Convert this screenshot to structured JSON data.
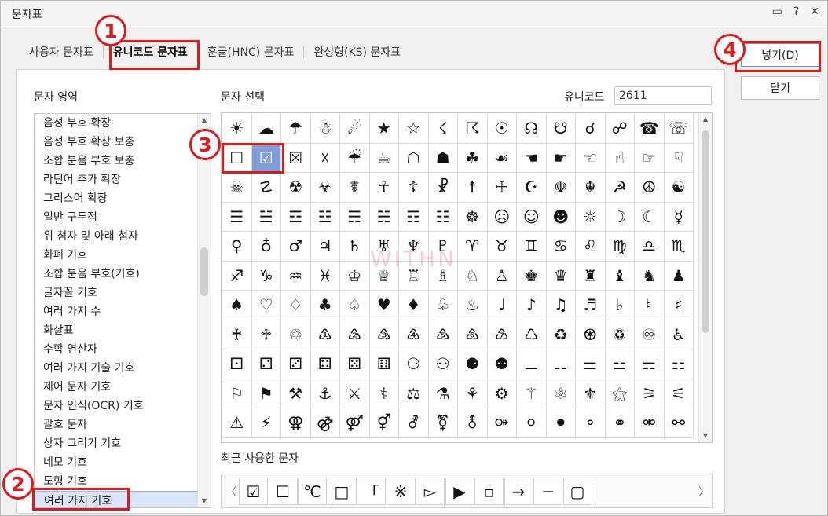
{
  "window": {
    "title": "문자표",
    "icons": [
      "comment-icon",
      "help-icon",
      "close-icon"
    ],
    "help_glyph": "?",
    "close_glyph": "✕",
    "comment_glyph": "▭"
  },
  "tabs": [
    {
      "label": "사용자 문자표",
      "active": false
    },
    {
      "label": "유니코드 문자표",
      "active": true
    },
    {
      "label": "훈글(HNC) 문자표",
      "active": false
    },
    {
      "label": "완성형(KS) 문자표",
      "active": false
    }
  ],
  "left": {
    "label": "문자 영역",
    "items": [
      "음성 부호 확장",
      "음성 부호 확장 보충",
      "조합 분음 부호 보충",
      "라틴어 추가 확장",
      "그리스어 확장",
      "일반 구두점",
      "위 첨자 및 아래 첨자",
      "화폐 기호",
      "조합 분음 부호(기호)",
      "글자꼴 기호",
      "여러 가지 수",
      "화살표",
      "수학 연산자",
      "여러 가지 기술 기호",
      "제어 문자 기호",
      "문자 인식(OCR) 기호",
      "괄호 문자",
      "상자 그리기 기호",
      "네모 기호",
      "도형 기호",
      "여러 가지 기호"
    ],
    "selected_index": 20
  },
  "center": {
    "label": "문자 선택",
    "unicode_label": "유니코드",
    "unicode_value": "2611",
    "selected_row": 1,
    "selected_col": 1,
    "rows": [
      [
        "☀",
        "☁",
        "☂",
        "☃",
        "☄",
        "★",
        "☆",
        "☇",
        "☈",
        "☉",
        "☊",
        "☋",
        "☌",
        "☍",
        "☎",
        "☏"
      ],
      [
        "☐",
        "☑",
        "☒",
        "☓",
        "☔",
        "☕",
        "☖",
        "☗",
        "☘",
        "☙",
        "☚",
        "☛",
        "☜",
        "☝",
        "☞",
        "☟"
      ],
      [
        "☠",
        "☡",
        "☢",
        "☣",
        "☤",
        "☥",
        "☦",
        "☧",
        "☨",
        "☩",
        "☪",
        "☫",
        "☬",
        "☭",
        "☮",
        "☯"
      ],
      [
        "☰",
        "☱",
        "☲",
        "☳",
        "☴",
        "☵",
        "☶",
        "☷",
        "☸",
        "☹",
        "☺",
        "☻",
        "☼",
        "☽",
        "☾",
        "☿"
      ],
      [
        "♀",
        "♁",
        "♂",
        "♃",
        "♄",
        "♅",
        "♆",
        "♇",
        "♈",
        "♉",
        "♊",
        "♋",
        "♌",
        "♍",
        "♎",
        "♏"
      ],
      [
        "♐",
        "♑",
        "♒",
        "♓",
        "♔",
        "♕",
        "♖",
        "♗",
        "♘",
        "♙",
        "♚",
        "♛",
        "♜",
        "♝",
        "♞",
        "♟"
      ],
      [
        "♠",
        "♡",
        "♢",
        "♣",
        "♤",
        "♥",
        "♦",
        "♧",
        "♨",
        "♩",
        "♪",
        "♫",
        "♬",
        "♭",
        "♮",
        "♯"
      ],
      [
        "♰",
        "♱",
        "♲",
        "♳",
        "♴",
        "♵",
        "♶",
        "♷",
        "♸",
        "♹",
        "♺",
        "♻",
        "♼",
        "♽",
        "♾",
        "♿"
      ],
      [
        "⚀",
        "⚁",
        "⚂",
        "⚃",
        "⚄",
        "⚅",
        "⚆",
        "⚇",
        "⚈",
        "⚉",
        "⚊",
        "⚋",
        "⚌",
        "⚍",
        "⚎",
        "⚏"
      ],
      [
        "⚐",
        "⚑",
        "⚒",
        "⚓",
        "⚔",
        "⚕",
        "⚖",
        "⚗",
        "⚘",
        "⚙",
        "⚚",
        "⚛",
        "⚜",
        "⚝",
        "⚞",
        "⚟"
      ],
      [
        "⚠",
        "⚡",
        "⚢",
        "⚣",
        "⚤",
        "⚥",
        "⚦",
        "⚧",
        "⚨",
        "⚩",
        "⚪",
        "⚫",
        "⚬",
        "⚭",
        "⚮",
        "⚯"
      ]
    ],
    "watermark": "WITHN"
  },
  "recent": {
    "label": "최근 사용한 문자",
    "items": [
      "☑",
      "☐",
      "℃",
      "□",
      "「",
      "※",
      "▻",
      "▶",
      "▫",
      "→",
      "─",
      "▢"
    ],
    "prev": "〈",
    "next": "〉"
  },
  "buttons": {
    "insert": "넣기(D)",
    "close": "닫기"
  },
  "annotations": [
    "1",
    "2",
    "3",
    "4"
  ],
  "colors": {
    "annotation": "#e01818",
    "selection": "#7f9fdc",
    "list_selection": "#d9e4f7"
  }
}
